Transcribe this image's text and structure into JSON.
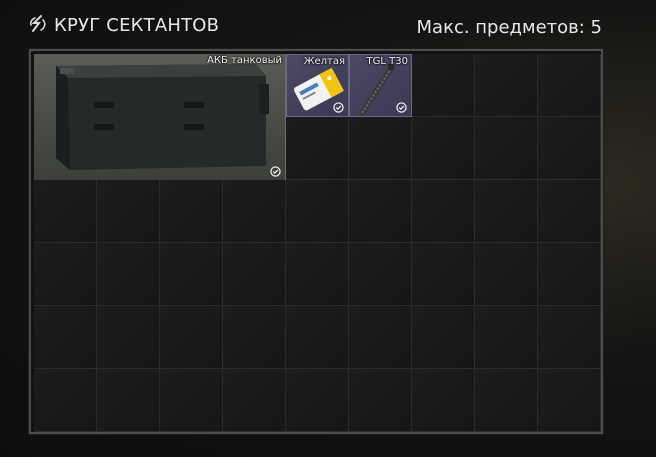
{
  "header": {
    "title": "КРУГ СЕКТАНТОВ",
    "max_items": "Макс. предметов: 5",
    "icon": "cultist-circle-icon"
  },
  "grid": {
    "columns": 9,
    "rows": 6
  },
  "items": [
    {
      "name": "АКБ танковый",
      "icon": "tank-battery-icon",
      "checked": true
    },
    {
      "name": "Желтая",
      "icon": "yellow-keycard-icon",
      "checked": true
    },
    {
      "name": "TGL T30",
      "icon": "tgl-t30-icon",
      "checked": true
    }
  ]
}
